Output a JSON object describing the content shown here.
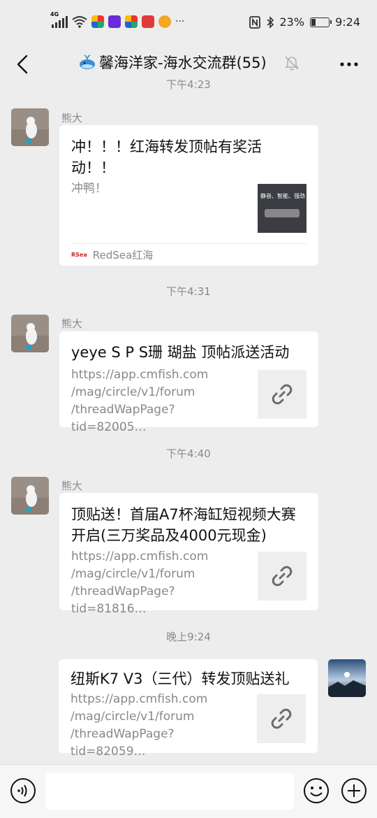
{
  "status_bar": {
    "network": "4G",
    "battery": "23%",
    "battery_level": 0.23,
    "time": "9:24",
    "overflow": "···"
  },
  "header": {
    "title": "馨海洋家-海水交流群(55)",
    "icons": [
      "back-icon",
      "whale-icon",
      "mute-icon",
      "more-icon"
    ]
  },
  "messages": [
    {
      "timestamp": "下午4:23",
      "sender": "熊大",
      "title": "冲！！！红海转发顶帖有奖活动！！",
      "desc": "冲鸭！",
      "thumb_text": "静音、智能、强劲",
      "source": "RedSea红海"
    },
    {
      "timestamp": "下午4:31",
      "sender": "熊大",
      "title": "yeye S P S珊 瑚盐 顶帖派送活动",
      "desc": "https://app.cmfish.com\n/mag/circle/v1/forum\n/threadWapPage?tid=82005…"
    },
    {
      "timestamp": "下午4:40",
      "sender": "熊大",
      "title": "顶贴送！首届A7杯海缸短视频大赛开启(三万奖品及4000元现金)",
      "desc": "https://app.cmfish.com\n/mag/circle/v1/forum\n/threadWapPage?tid=81816…"
    },
    {
      "timestamp": "晚上9:24",
      "title": "纽斯K7 V3（三代）转发顶贴送礼",
      "desc": "https://app.cmfish.com\n/mag/circle/v1/forum\n/threadWapPage?tid=82059…"
    }
  ],
  "input_bar": {
    "placeholder": "",
    "icons": [
      "voice-icon",
      "emoji-icon",
      "plus-icon"
    ]
  },
  "colors": {
    "background": "#ededed",
    "bubble": "#ffffff",
    "meta_text": "#8a8a8a"
  }
}
